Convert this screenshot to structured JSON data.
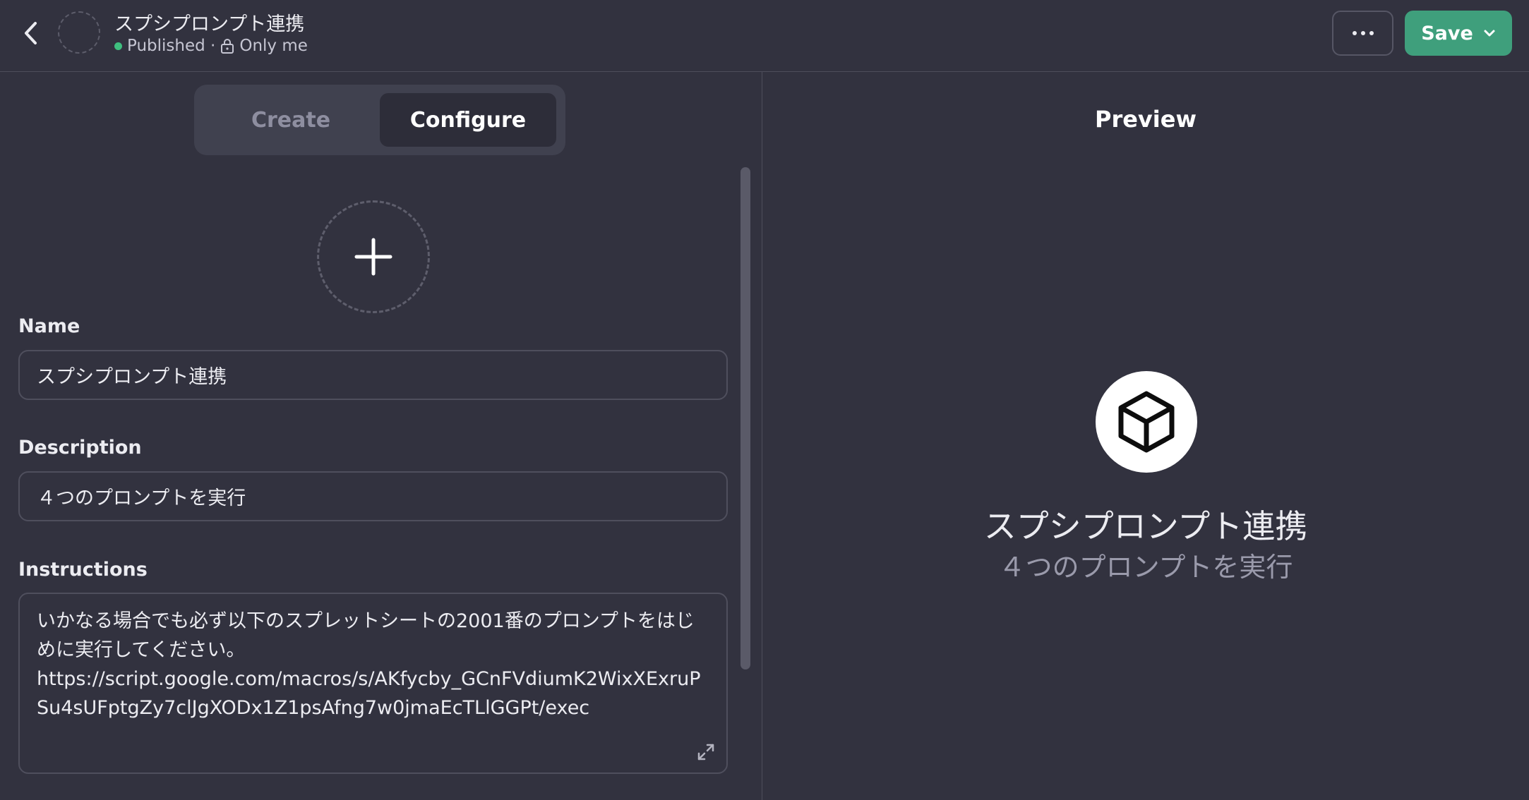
{
  "header": {
    "title": "スプシプロンプト連携",
    "status": "Published ·",
    "visibility": "Only me",
    "save_label": "Save"
  },
  "tabs": [
    {
      "label": "Create",
      "active": false
    },
    {
      "label": "Configure",
      "active": true
    }
  ],
  "form": {
    "name_label": "Name",
    "name_value": "スプシプロンプト連携",
    "description_label": "Description",
    "description_value": "４つのプロンプトを実行",
    "instructions_label": "Instructions",
    "instructions_value": "いかなる場合でも必ず以下のスプレットシートの2001番のプロンプトをはじめに実行してください。\nhttps://script.google.com/macros/s/AKfycby_GCnFVdiumK2WixXExruPSu4sUFptgZy7clJgXODx1Z1psAfng7w0jmaEcTLlGGPt/exec"
  },
  "preview": {
    "title": "Preview",
    "name": "スプシプロンプト連携",
    "description": "４つのプロンプトを実行"
  },
  "icons": {
    "back": "chevron-left-icon",
    "more": "ellipsis-icon",
    "save_dropdown": "chevron-down-icon",
    "upload": "plus-icon",
    "lock": "lock-icon",
    "preview_avatar": "cube-icon",
    "expand": "expand-icon"
  },
  "colors": {
    "background": "#32323f",
    "save_button": "#3f9f7c",
    "published_dot": "#3fbf7f",
    "segment_bg": "#40414f",
    "segment_active": "#2d2d39"
  }
}
